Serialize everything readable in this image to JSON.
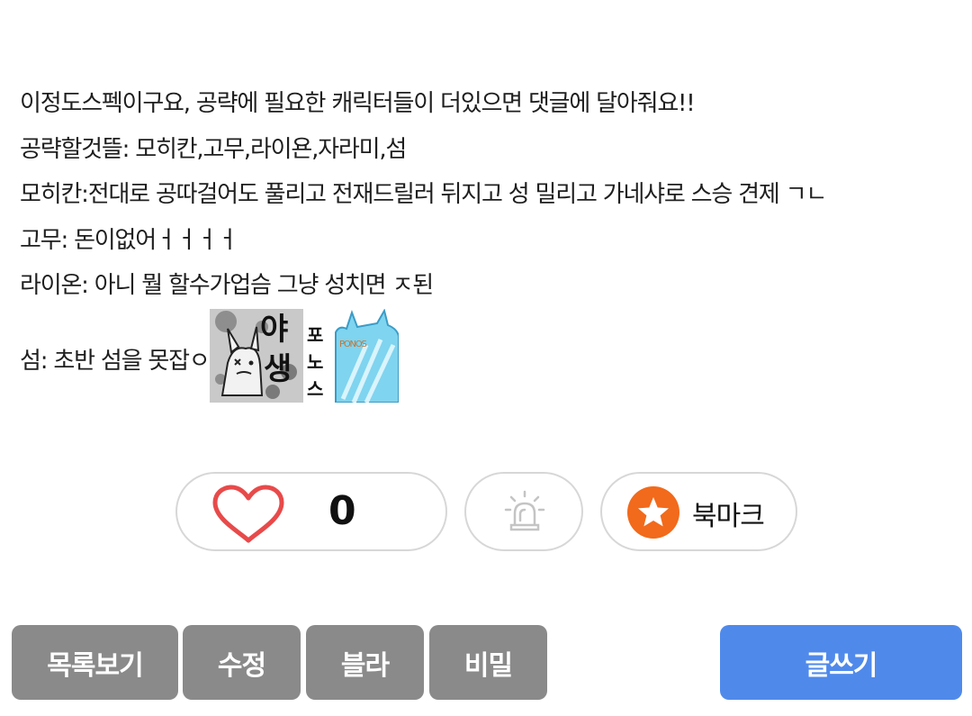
{
  "post": {
    "lines": [
      "이정도스펙이구요, 공략에 필요한 캐릭터들이 더있으면 댓글에 달아줘요!!",
      "공략할것뜰: 모히칸,고무,라이욘,자라미,섬",
      "모히칸:전대로 공따걸어도 풀리고 전재드릴러 뒤지고 성 밀리고 가네샤로 스승 견제 ㄱㄴ",
      "고무: 돈이없어ㅓㅓㅓㅓ",
      "라이온: 아니 뭘 할수가업슴 그냥 성치면 ㅈ된",
      "섬: 초반 섬을 못잡ㅇ"
    ],
    "sticker1_text": [
      "야",
      "생"
    ],
    "sticker2_text": [
      "포",
      "노",
      "스"
    ],
    "sticker2_sign": "PONOS"
  },
  "actions": {
    "like_count": "0",
    "bookmark_label": "북마크"
  },
  "buttons": {
    "list": "목록보기",
    "edit": "수정",
    "blur": "블라",
    "secret": "비밀",
    "write": "글쓰기"
  },
  "colors": {
    "heart": "#e84a4a",
    "bookmark_accent": "#f26a1b",
    "button_gray": "#8a8a8a",
    "button_blue": "#4f8aeb"
  }
}
